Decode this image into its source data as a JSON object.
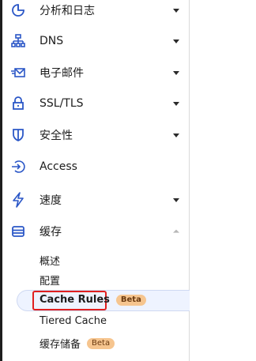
{
  "sidebar": {
    "items": [
      {
        "label": "分析和日志",
        "icon": "analytics-icon",
        "expandable": true
      },
      {
        "label": "DNS",
        "icon": "dns-network-icon",
        "expandable": true
      },
      {
        "label": "电子邮件",
        "icon": "email-icon",
        "expandable": true
      },
      {
        "label": "SSL/TLS",
        "icon": "lock-icon",
        "expandable": true
      },
      {
        "label": "安全性",
        "icon": "shield-icon",
        "expandable": true
      },
      {
        "label": "Access",
        "icon": "access-icon",
        "expandable": false
      },
      {
        "label": "速度",
        "icon": "lightning-icon",
        "expandable": true
      },
      {
        "label": "缓存",
        "icon": "cache-storage-icon",
        "expandable": true,
        "expanded": true
      }
    ],
    "cache_submenu": [
      {
        "label": "概述"
      },
      {
        "label": "配置"
      },
      {
        "label": "Cache Rules",
        "badge": "Beta",
        "active": true
      },
      {
        "label": "Tiered Cache"
      },
      {
        "label": "缓存储备",
        "badge": "Beta"
      }
    ]
  },
  "colors": {
    "icon": "#2b57c7",
    "badge_bg": "#f6c58f",
    "highlight_border": "#e02020",
    "active_bg": "#eef3ff"
  }
}
